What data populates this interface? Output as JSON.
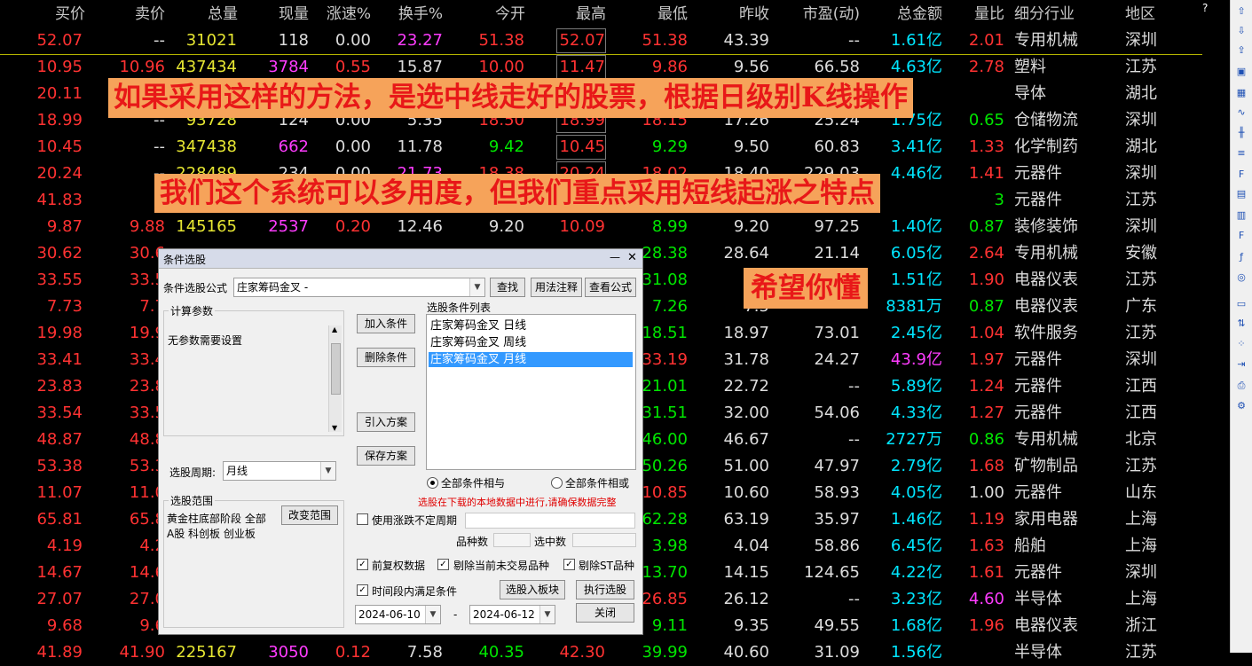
{
  "headers": [
    "买价",
    "卖价",
    "总量",
    "现量",
    "涨速%",
    "换手%",
    "今开",
    "最高",
    "最低",
    "昨收",
    "市盈(动)",
    "总金额",
    "量比",
    "细分行业",
    "地区"
  ],
  "rows": [
    {
      "buy": "52.07",
      "sell": "--",
      "vol": "31021",
      "cur": "118",
      "speed": "0.00",
      "turn": "23.27",
      "open": "51.38",
      "high": "52.07",
      "low": "51.38",
      "prev": "43.39",
      "pe": "--",
      "amt": "1.61亿",
      "ratio": "2.01",
      "ind": "专用机械",
      "region": "深圳"
    },
    {
      "buy": "10.95",
      "sell": "10.96",
      "vol": "437434",
      "cur": "3784",
      "speed": "0.55",
      "turn": "15.87",
      "open": "10.00",
      "high": "11.47",
      "low": "9.86",
      "prev": "9.56",
      "pe": "66.58",
      "amt": "4.63亿",
      "ratio": "2.78",
      "ind": "塑料",
      "region": "江苏"
    },
    {
      "buy": "20.11",
      "sell": "",
      "vol": "",
      "cur": "",
      "speed": "",
      "turn": "",
      "open": "",
      "high": "",
      "low": "",
      "prev": "",
      "pe": "",
      "amt": "",
      "ratio": "",
      "ind": "导体",
      "region": "湖北"
    },
    {
      "buy": "18.99",
      "sell": "--",
      "vol": "93728",
      "cur": "124",
      "speed": "0.00",
      "turn": "5.35",
      "open": "18.50",
      "high": "18.99",
      "low": "18.15",
      "prev": "17.26",
      "pe": "25.24",
      "amt": "1.75亿",
      "ratio": "0.65",
      "ind": "仓储物流",
      "region": "深圳"
    },
    {
      "buy": "10.45",
      "sell": "--",
      "vol": "347438",
      "cur": "662",
      "speed": "0.00",
      "turn": "11.78",
      "open": "9.42",
      "high": "10.45",
      "low": "9.29",
      "prev": "9.50",
      "pe": "60.83",
      "amt": "3.41亿",
      "ratio": "1.33",
      "ind": "化学制药",
      "region": "湖北"
    },
    {
      "buy": "20.24",
      "sell": "--",
      "vol": "228489",
      "cur": "234",
      "speed": "0.00",
      "turn": "21.73",
      "open": "18.38",
      "high": "20.24",
      "low": "18.02",
      "prev": "18.40",
      "pe": "229.03",
      "amt": "4.46亿",
      "ratio": "1.41",
      "ind": "元器件",
      "region": "深圳"
    },
    {
      "buy": "41.83",
      "sell": "",
      "vol": "",
      "cur": "",
      "speed": "",
      "turn": "",
      "open": "",
      "high": "",
      "low": "",
      "prev": "",
      "pe": "",
      "amt": "",
      "ratio": "3",
      "ind": "元器件",
      "region": "江苏"
    },
    {
      "buy": "9.87",
      "sell": "9.88",
      "vol": "145165",
      "cur": "2537",
      "speed": "0.20",
      "turn": "12.46",
      "open": "9.20",
      "high": "10.09",
      "low": "8.99",
      "prev": "9.20",
      "pe": "97.25",
      "amt": "1.40亿",
      "ratio": "0.87",
      "ind": "装修装饰",
      "region": "深圳"
    },
    {
      "buy": "30.62",
      "sell": "30.6",
      "low": "28.38",
      "prev": "28.64",
      "pe": "21.14",
      "amt": "6.05亿",
      "ratio": "2.64",
      "ind": "专用机械",
      "region": "安徽"
    },
    {
      "buy": "33.55",
      "sell": "33.5",
      "low": "31.08",
      "prev": "31",
      "pe": "",
      "amt": "1.51亿",
      "ratio": "1.90",
      "ind": "电器仪表",
      "region": "江苏"
    },
    {
      "buy": "7.73",
      "sell": "7.7",
      "low": "7.26",
      "prev": "7.5",
      "pe": "",
      "amt": "8381万",
      "ratio": "0.87",
      "ind": "电器仪表",
      "region": "广东"
    },
    {
      "buy": "19.98",
      "sell": "19.9",
      "low": "18.51",
      "prev": "18.97",
      "pe": "73.01",
      "amt": "2.45亿",
      "ratio": "1.04",
      "ind": "软件服务",
      "region": "江苏"
    },
    {
      "buy": "33.41",
      "sell": "33.4",
      "low": "33.19",
      "prev": "31.78",
      "pe": "24.27",
      "amt": "43.9亿",
      "ratio": "1.97",
      "ind": "元器件",
      "region": "深圳"
    },
    {
      "buy": "23.83",
      "sell": "23.8",
      "low": "21.01",
      "prev": "22.72",
      "pe": "--",
      "amt": "5.89亿",
      "ratio": "1.24",
      "ind": "元器件",
      "region": "江西"
    },
    {
      "buy": "33.54",
      "sell": "33.5",
      "low": "31.51",
      "prev": "32.00",
      "pe": "54.06",
      "amt": "4.33亿",
      "ratio": "1.27",
      "ind": "元器件",
      "region": "江西"
    },
    {
      "buy": "48.87",
      "sell": "48.8",
      "low": "46.00",
      "prev": "46.67",
      "pe": "--",
      "amt": "2727万",
      "ratio": "0.86",
      "ind": "专用机械",
      "region": "北京"
    },
    {
      "buy": "53.38",
      "sell": "53.3",
      "low": "50.26",
      "prev": "51.00",
      "pe": "47.97",
      "amt": "2.79亿",
      "ratio": "1.68",
      "ind": "矿物制品",
      "region": "江苏"
    },
    {
      "buy": "11.07",
      "sell": "11.0",
      "low": "10.85",
      "prev": "10.60",
      "pe": "58.93",
      "amt": "4.05亿",
      "ratio": "1.00",
      "ind": "元器件",
      "region": "山东"
    },
    {
      "buy": "65.81",
      "sell": "65.8",
      "low": "62.28",
      "prev": "63.19",
      "pe": "35.97",
      "amt": "1.46亿",
      "ratio": "1.19",
      "ind": "家用电器",
      "region": "上海"
    },
    {
      "buy": "4.19",
      "sell": "4.2",
      "low": "3.98",
      "prev": "4.04",
      "pe": "58.86",
      "amt": "6.45亿",
      "ratio": "1.63",
      "ind": "船舶",
      "region": "上海"
    },
    {
      "buy": "14.67",
      "sell": "14.6",
      "low": "13.70",
      "prev": "14.15",
      "pe": "124.65",
      "amt": "4.22亿",
      "ratio": "1.61",
      "ind": "元器件",
      "region": "深圳"
    },
    {
      "buy": "27.07",
      "sell": "27.0",
      "low": "26.85",
      "prev": "26.12",
      "pe": "--",
      "amt": "3.23亿",
      "ratio": "4.60",
      "ind": "半导体",
      "region": "上海"
    },
    {
      "buy": "9.68",
      "sell": "9.6",
      "low": "9.11",
      "prev": "9.35",
      "pe": "49.55",
      "amt": "1.68亿",
      "ratio": "1.96",
      "ind": "电器仪表",
      "region": "浙江"
    },
    {
      "buy": "41.89",
      "sell": "41.90",
      "vol": "225167",
      "cur": "3050",
      "speed": "0.12",
      "turn": "7.58",
      "open": "40.35",
      "high": "42.30",
      "low": "39.99",
      "prev": "40.60",
      "pe": "31.09",
      "amt": "1.56亿",
      "ratio": "",
      "ind": "半导体",
      "region": "江苏"
    }
  ],
  "banners": {
    "b1": "如果采用这样的方法，是选中线走好的股票，根据日级别K线操作",
    "b2": "我们这个系统可以多用度，但我们重点采用短线起涨之特点",
    "b3": "希望你懂"
  },
  "help_mark": "?",
  "dialog": {
    "title": "条件选股",
    "formula_label": "条件选股公式",
    "formula_value": "庄家筹码金叉  -",
    "btn_find": "查找",
    "btn_usage": "用法注释",
    "btn_view": "查看公式",
    "params_group": "计算参数",
    "params_text": "无参数需要设置",
    "btn_add": "加入条件",
    "btn_delete": "删除条件",
    "btn_import": "引入方案",
    "btn_save": "保存方案",
    "list_label": "选股条件列表",
    "list_items": [
      "庄家筹码金叉  日线",
      "庄家筹码金叉  周线",
      "庄家筹码金叉  月线"
    ],
    "period_label": "选股周期:",
    "period_value": "月线",
    "and_label": "全部条件相与",
    "or_label": "全部条件相或",
    "notice": "选股在下载的本地数据中进行,请确保数据完整",
    "range_group": "选股范围",
    "range_text1": "黄金柱底部阶段 全部",
    "range_text2": "A股 科创板 创业板",
    "btn_range": "改变范围",
    "use_period": "使用涨跌不定周期",
    "count_label": "品种数",
    "selected_label": "选中数",
    "adj_label": "前复权数据",
    "exclude_label": "剔除当前未交易品种",
    "st_label": "剔除ST品种",
    "timerange_label": "时间段内满足条件",
    "btn_to_block": "选股入板块",
    "btn_run": "执行选股",
    "btn_close": "关闭",
    "date_from": "2024-06-10",
    "date_to": "2024-06-12",
    "dash": "-",
    "win_min": "—",
    "win_close": "✕"
  },
  "sidebar_icons": [
    "arrow-up-icon",
    "arrow-down-icon",
    "export-icon",
    "save-icon",
    "grid-icon",
    "line-chart-icon",
    "candle-icon",
    "list-icon",
    "f10-icon",
    "sheet-icon",
    "book-icon",
    "f12-icon",
    "fx-icon",
    "circle-icon",
    "folder-icon",
    "updown-icon",
    "scatter-icon",
    "arrow-in-icon",
    "printer-icon",
    "gear-icon"
  ]
}
